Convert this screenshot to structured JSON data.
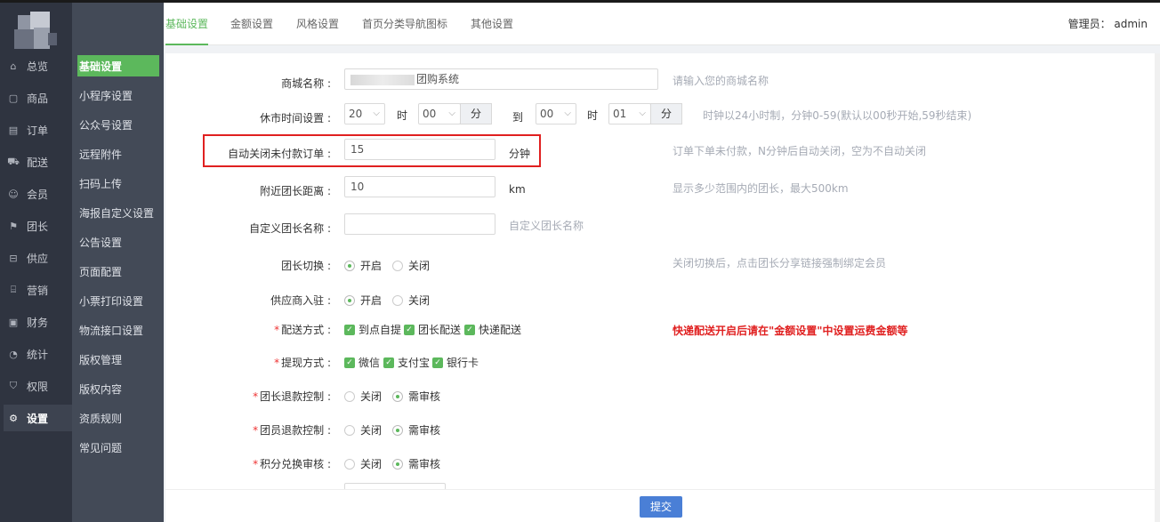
{
  "sidebar_primary": {
    "items": [
      {
        "label": "总览",
        "icon": "home-icon",
        "glyph": "⌂"
      },
      {
        "label": "商品",
        "icon": "goods-icon",
        "glyph": "▢"
      },
      {
        "label": "订单",
        "icon": "order-icon",
        "glyph": "▤"
      },
      {
        "label": "配送",
        "icon": "truck-icon",
        "glyph": "⛟"
      },
      {
        "label": "会员",
        "icon": "user-icon",
        "glyph": "☺"
      },
      {
        "label": "团长",
        "icon": "leader-icon",
        "glyph": "⚑"
      },
      {
        "label": "供应",
        "icon": "supply-icon",
        "glyph": "⊟"
      },
      {
        "label": "营销",
        "icon": "gift-icon",
        "glyph": "⌸"
      },
      {
        "label": "财务",
        "icon": "finance-icon",
        "glyph": "▣"
      },
      {
        "label": "统计",
        "icon": "chart-icon",
        "glyph": "◔"
      },
      {
        "label": "权限",
        "icon": "shield-icon",
        "glyph": "⛉"
      },
      {
        "label": "设置",
        "icon": "gear-icon",
        "glyph": "⚙"
      }
    ]
  },
  "sidebar_secondary": {
    "items": [
      {
        "label": "基础设置"
      },
      {
        "label": "小程序设置"
      },
      {
        "label": "公众号设置"
      },
      {
        "label": "远程附件"
      },
      {
        "label": "扫码上传"
      },
      {
        "label": "海报自定义设置"
      },
      {
        "label": "公告设置"
      },
      {
        "label": "页面配置"
      },
      {
        "label": "小票打印设置"
      },
      {
        "label": "物流接口设置"
      },
      {
        "label": "版权管理"
      },
      {
        "label": "版权内容"
      },
      {
        "label": "资质规则"
      },
      {
        "label": "常见问题"
      }
    ]
  },
  "tabs": [
    {
      "label": "基础设置"
    },
    {
      "label": "金额设置"
    },
    {
      "label": "风格设置"
    },
    {
      "label": "首页分类导航图标"
    },
    {
      "label": "其他设置"
    }
  ],
  "admin_label": "管理员： admin",
  "form": {
    "shop_name": {
      "label": "商城名称 :",
      "value": "团购系统",
      "hint": "请输入您的商城名称"
    },
    "rest_time": {
      "label": "休市时间设置 :",
      "start_hour": "20",
      "start_min": "00",
      "end_hour": "00",
      "end_min": "01",
      "hour_unit": "时",
      "min_unit": "分",
      "to": "到",
      "hint": "时钟以24小时制，分钟0-59(默认以00秒开始,59秒结束)"
    },
    "auto_close": {
      "label": "自动关闭未付款订单 :",
      "value": "15",
      "unit": "分钟",
      "hint": "订单下单未付款，N分钟后自动关闭，空为不自动关闭"
    },
    "nearby_distance": {
      "label": "附近团长距离 :",
      "value": "10",
      "unit": "km",
      "hint": "显示多少范围内的团长，最大500km"
    },
    "leader_name": {
      "label": "自定义团长名称 :",
      "value": "",
      "hint": "自定义团长名称"
    },
    "leader_switch": {
      "label": "团长切换 :",
      "on": "开启",
      "off": "关闭",
      "hint": "关闭切换后，点击团长分享链接强制绑定会员"
    },
    "supplier_join": {
      "label": "供应商入驻 :",
      "on": "开启",
      "off": "关闭"
    },
    "delivery": {
      "required": "*",
      "label": "配送方式 :",
      "options": [
        "到点自提",
        "团长配送",
        "快递配送"
      ],
      "warning": "快递配送开启后请在\"金额设置\"中设置运费金额等"
    },
    "withdraw": {
      "required": "*",
      "label": "提现方式 :",
      "options": [
        "微信",
        "支付宝",
        "银行卡"
      ]
    },
    "leader_refund": {
      "required": "*",
      "label": "团长退款控制 :",
      "off": "关闭",
      "on": "需审核"
    },
    "member_refund": {
      "required": "*",
      "label": "团员退款控制 :",
      "off": "关闭",
      "on": "需审核"
    },
    "points_review": {
      "required": "*",
      "label": "积分兑换审核 :",
      "off": "关闭",
      "on": "需审核"
    }
  },
  "submit_label": "提交",
  "colors": {
    "accent": "#5cb85c",
    "warning": "#e02020",
    "submit": "#4a7fd6"
  }
}
